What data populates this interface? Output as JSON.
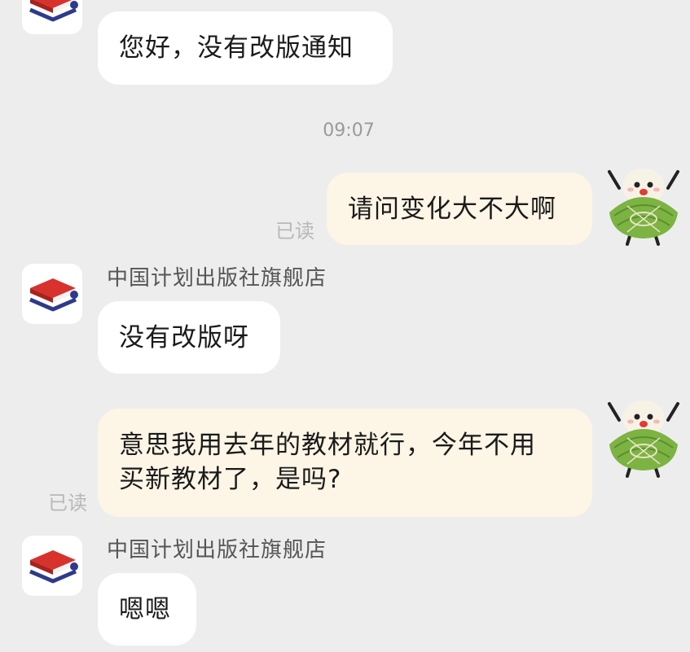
{
  "conversation": {
    "store_name": "中国计划出版社旗舰店",
    "timestamp": "09:07",
    "read_label": "已读",
    "messages": [
      {
        "from": "store",
        "text": "您好，没有改版通知"
      },
      {
        "from": "user",
        "text": "请问变化大不大啊",
        "status": "已读"
      },
      {
        "from": "store",
        "sender": "中国计划出版社旗舰店",
        "text": "没有改版呀"
      },
      {
        "from": "user",
        "text_line1": "意思我用去年的教材就行，今年不用",
        "text_line2": "买新教材了，是吗?",
        "status": "已读"
      },
      {
        "from": "store",
        "sender": "中国计划出版社旗舰店",
        "text": "嗯嗯"
      }
    ]
  },
  "icons": {
    "store_avatar": "red-book-stack-icon",
    "user_avatar": "zongzi-cartoon-icon"
  },
  "colors": {
    "background": "#ededed",
    "incoming_bubble": "#ffffff",
    "outgoing_bubble": "#fdf5e6",
    "book_red": "#d8322c",
    "book_navy": "#2e3a8c",
    "zongzi_green": "#7cb342"
  }
}
